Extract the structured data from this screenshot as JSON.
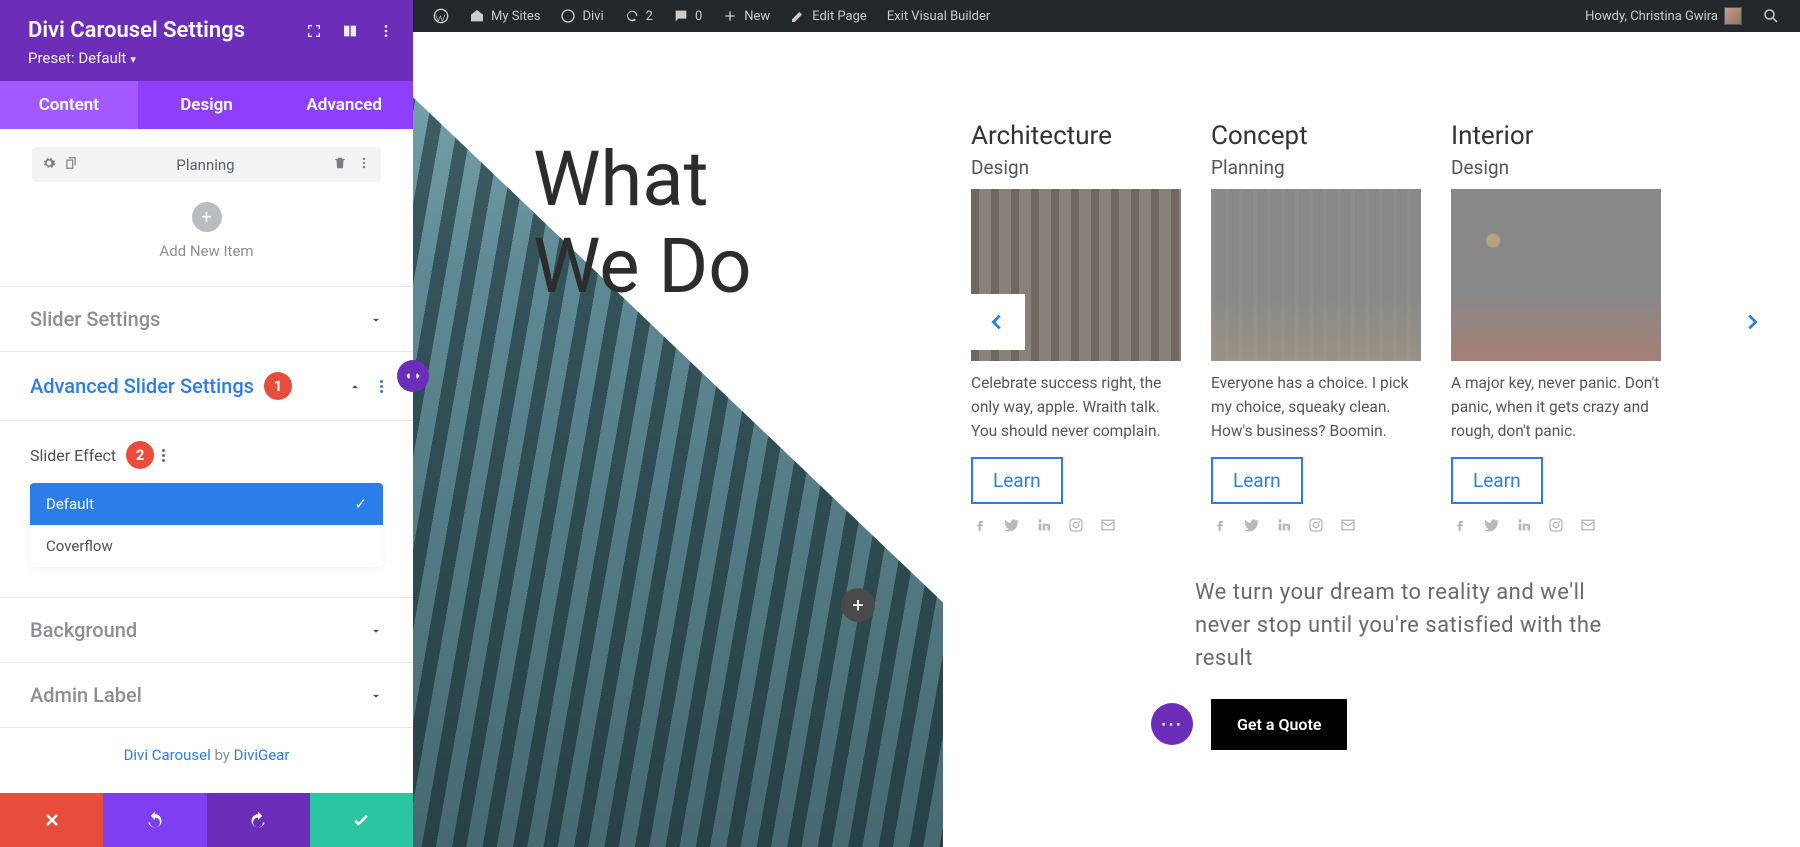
{
  "sidebar": {
    "title": "Divi Carousel Settings",
    "preset": "Preset: Default",
    "tabs": {
      "content": "Content",
      "design": "Design",
      "advanced": "Advanced"
    },
    "item_label": "Planning",
    "add_item": "Add New Item",
    "sections": {
      "slider": "Slider Settings",
      "advanced_slider": "Advanced Slider Settings",
      "background": "Background",
      "admin_label": "Admin Label"
    },
    "slider_effect_label": "Slider Effect",
    "effect_options": {
      "default": "Default",
      "coverflow": "Coverflow"
    },
    "badges": {
      "one": "1",
      "two": "2"
    },
    "credits": {
      "product": "Divi Carousel",
      "by": " by ",
      "author": "DiviGear"
    }
  },
  "adminbar": {
    "my_sites": "My Sites",
    "site": "Divi",
    "updates": "2",
    "comments": "0",
    "new": "New",
    "edit": "Edit Page",
    "exit": "Exit Visual Builder",
    "howdy": "Howdy, Christina Gwira"
  },
  "page": {
    "hero_title_l1": "What",
    "hero_title_l2": "We Do",
    "cards": [
      {
        "title": "Architecture",
        "sub": "Design",
        "text": " Celebrate success right, the only way, apple. Wraith talk. You should never complain.",
        "btn": "Learn"
      },
      {
        "title": "Concept",
        "sub": "Planning",
        "text": "Everyone has a choice. I pick my choice, squeaky clean. How's business? Boomin.",
        "btn": "Learn"
      },
      {
        "title": "Interior",
        "sub": "Design",
        "text": "A major key, never panic. Don't panic, when it gets crazy and rough, don't panic.",
        "btn": "Learn"
      }
    ],
    "tagline": "We turn your dream to reality and we'll never stop until you're satisfied with the result",
    "quote_btn": "Get a Quote"
  }
}
